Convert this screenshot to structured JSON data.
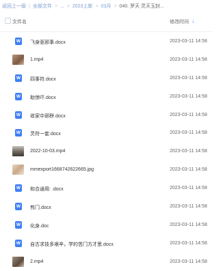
{
  "breadcrumb": [
    {
      "label": "返回上一级"
    },
    {
      "label": "全部文件"
    },
    {
      "label": "..."
    },
    {
      "label": "2023上新"
    },
    {
      "label": "03月"
    },
    {
      "label": "040. 罗天 灵天玉封..."
    }
  ],
  "header": {
    "name_label": "文件名",
    "date_label": "修改时间",
    "sort_icon": "sort-down-arrow"
  },
  "files": [
    {
      "name": "飞身驱邪事.docx",
      "date": "2023-03-11 14:58",
      "type": "doc"
    },
    {
      "name": "1.mp4",
      "date": "2023-03-11 14:58",
      "type": "video"
    },
    {
      "name": "四事符.docx",
      "date": "2023-03-11 14:58",
      "type": "doc"
    },
    {
      "name": "助惊吓.docx",
      "date": "2023-03-11 14:58",
      "type": "doc"
    },
    {
      "name": "收家中邪秽.docx",
      "date": "2023-03-11 14:58",
      "type": "doc"
    },
    {
      "name": "灵符一套.docx",
      "date": "2023-03-11 14:58",
      "type": "doc"
    },
    {
      "name": "2022-10-03.mp4",
      "date": "2023-03-11 14:58",
      "type": "video"
    },
    {
      "name": "mmexport1668742622665.jpg",
      "date": "2023-03-11 14:58",
      "type": "image"
    },
    {
      "name": "和合通用: .docx",
      "date": "2023-03-11 14:58",
      "type": "doc"
    },
    {
      "name": "煎门.docx",
      "date": "2023-03-11 14:58",
      "type": "doc"
    },
    {
      "name": "化身.doc",
      "date": "2023-03-11 14:58",
      "type": "doc"
    },
    {
      "name": "自古求技多艰辛，学的苦门方才思.docx",
      "date": "2023-03-11 14:58",
      "type": "doc"
    },
    {
      "name": "2.mp4",
      "date": "2023-03-11 14:58",
      "type": "video"
    }
  ],
  "colors": {
    "link": "#7a9ccf",
    "doc_icon": "#3f7ff6",
    "sort_accent": "#4a8cff"
  }
}
